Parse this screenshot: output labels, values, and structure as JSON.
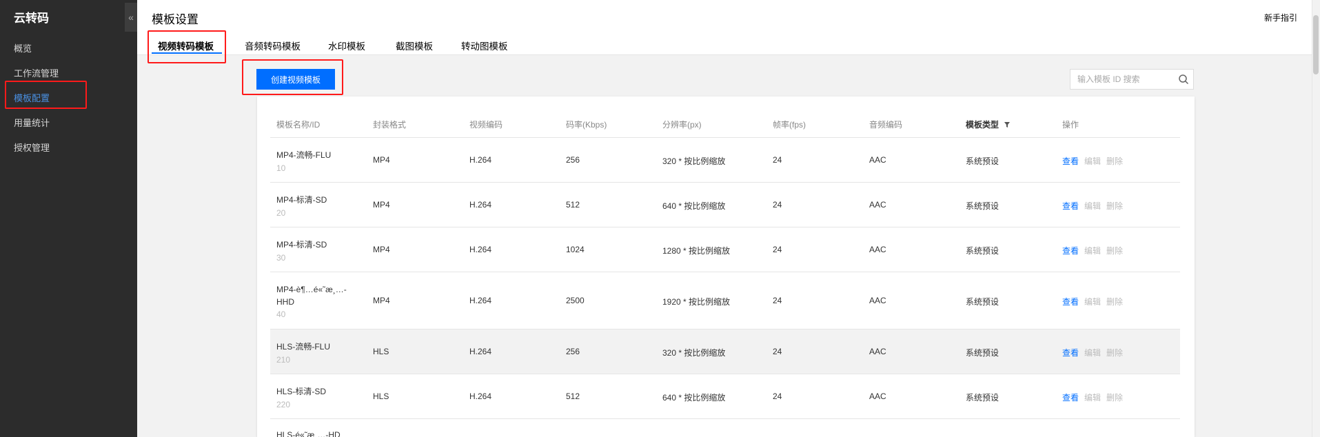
{
  "app": {
    "name": "云转码",
    "collapse_glyph": "«"
  },
  "sidebar": {
    "items": [
      {
        "label": "概览"
      },
      {
        "label": "工作流管理"
      },
      {
        "label": "模板配置"
      },
      {
        "label": "用量统计"
      },
      {
        "label": "授权管理"
      }
    ],
    "active_index": 2
  },
  "header": {
    "title": "模板设置",
    "guide_link": "新手指引",
    "tabs": [
      {
        "label": "视频转码模板"
      },
      {
        "label": "音频转码模板"
      },
      {
        "label": "水印模板"
      },
      {
        "label": "截图模板"
      },
      {
        "label": "转动图模板"
      }
    ]
  },
  "toolbar": {
    "create_button": "创建视频模板",
    "search_placeholder": "输入模板 ID 搜索"
  },
  "table": {
    "columns": [
      "模板名称/ID",
      "封装格式",
      "视频编码",
      "码率(Kbps)",
      "分辨率(px)",
      "帧率(fps)",
      "音频编码",
      "模板类型",
      "操作"
    ],
    "actions": {
      "view": "查看",
      "edit": "编辑",
      "delete": "删除"
    },
    "rows": [
      {
        "name": "MP4-流畅-FLU",
        "id": "10",
        "format": "MP4",
        "vcodec": "H.264",
        "bitrate": "256",
        "resolution": "320 * 按比例缩放",
        "fps": "24",
        "acodec": "AAC",
        "type": "系统预设"
      },
      {
        "name": "MP4-标清-SD",
        "id": "20",
        "format": "MP4",
        "vcodec": "H.264",
        "bitrate": "512",
        "resolution": "640 * 按比例缩放",
        "fps": "24",
        "acodec": "AAC",
        "type": "系统预设"
      },
      {
        "name": "MP4-标清-SD",
        "id": "30",
        "format": "MP4",
        "vcodec": "H.264",
        "bitrate": "1024",
        "resolution": "1280 * 按比例缩放",
        "fps": "24",
        "acodec": "AAC",
        "type": "系统预设"
      },
      {
        "name_line1": "MP4-è¶…é«˜æ¸…-",
        "name_line2": "HHD",
        "id": "40",
        "format": "MP4",
        "vcodec": "H.264",
        "bitrate": "2500",
        "resolution": "1920 * 按比例缩放",
        "fps": "24",
        "acodec": "AAC",
        "type": "系统预设"
      },
      {
        "name": "HLS-流畅-FLU",
        "id": "210",
        "format": "HLS",
        "vcodec": "H.264",
        "bitrate": "256",
        "resolution": "320 * 按比例缩放",
        "fps": "24",
        "acodec": "AAC",
        "type": "系统预设"
      },
      {
        "name": "HLS-标清-SD",
        "id": "220",
        "format": "HLS",
        "vcodec": "H.264",
        "bitrate": "512",
        "resolution": "640 * 按比例缩放",
        "fps": "24",
        "acodec": "AAC",
        "type": "系统预设"
      },
      {
        "name": "HLS-é«˜æ¸…-HD"
      }
    ]
  },
  "colors": {
    "sidebar_bg": "#2c2c2c",
    "accent": "#006eff",
    "active_nav": "#4a90e2",
    "annotation": "#ff1a1a"
  }
}
